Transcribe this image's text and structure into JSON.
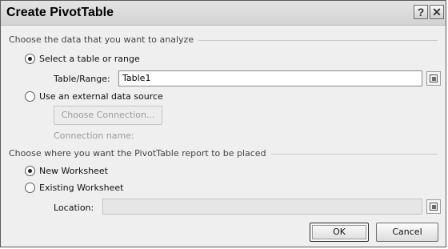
{
  "window": {
    "title": "Create PivotTable",
    "help_glyph": "?",
    "close_glyph": "✕"
  },
  "source_section": {
    "heading": "Choose the data that you want to analyze",
    "option_table": {
      "label": "Select a table or range",
      "selected": true
    },
    "table_range": {
      "label": "Table/Range:",
      "value": "Table1"
    },
    "option_external": {
      "label": "Use an external data source",
      "selected": false
    },
    "choose_connection_label": "Choose Connection...",
    "connection_name_label": "Connection name:"
  },
  "placement_section": {
    "heading": "Choose where you want the PivotTable report to be placed",
    "option_new": {
      "label": "New Worksheet",
      "selected": true
    },
    "option_existing": {
      "label": "Existing Worksheet",
      "selected": false
    },
    "location": {
      "label": "Location:",
      "value": ""
    }
  },
  "buttons": {
    "ok_label": "OK",
    "cancel_label": "Cancel"
  },
  "icons": [
    "help-icon",
    "close-icon",
    "range-picker-icon",
    "radio-selected-icon"
  ]
}
